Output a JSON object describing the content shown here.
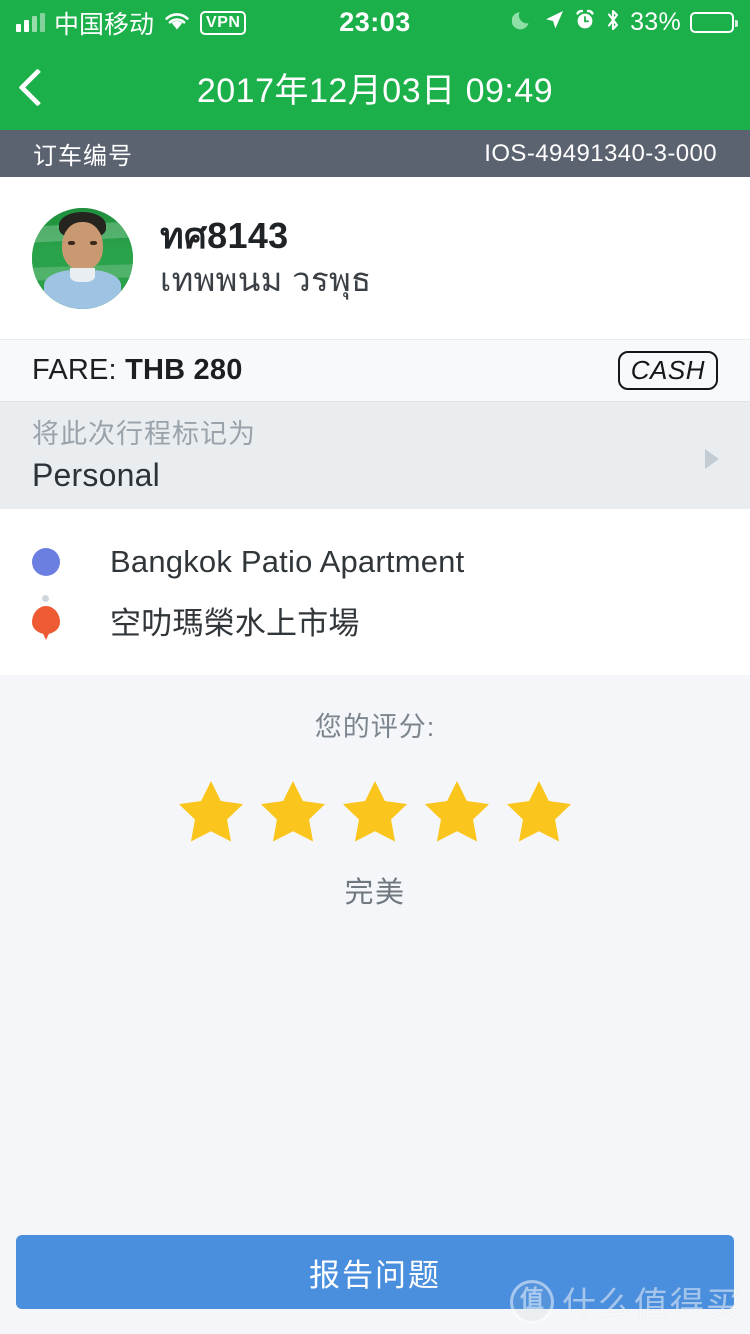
{
  "status_bar": {
    "carrier": "中国移动",
    "vpn": "VPN",
    "time": "23:03",
    "battery_percent": "33%",
    "icons": [
      "signal-icon",
      "wifi-icon",
      "vpn-badge",
      "moon-icon",
      "location-arrow-icon",
      "alarm-clock-icon",
      "bluetooth-icon",
      "battery-icon"
    ]
  },
  "nav": {
    "back_icon": "chevron-left-icon",
    "title": "2017年12月03日 09:49"
  },
  "order": {
    "label": "订车编号",
    "value": "IOS-49491340-3-000"
  },
  "driver": {
    "id": "ทศ8143",
    "name": "เทพพนม วรพุธ",
    "avatar_alt": "driver-photo"
  },
  "fare": {
    "label": "FARE:",
    "amount": "THB 280",
    "payment_badge": "CASH"
  },
  "trip_tag": {
    "caption": "将此次行程标记为",
    "value": "Personal",
    "arrow_icon": "triangle-right-icon"
  },
  "route": {
    "pickup": "Bangkok Patio Apartment",
    "dropoff": "空叻瑪榮水上市場",
    "pickup_icon": "circle-dot-icon",
    "dropoff_icon": "map-pin-icon"
  },
  "rating": {
    "caption": "您的评分:",
    "stars_filled": 5,
    "stars_total": 5,
    "word": "完美"
  },
  "footer": {
    "report_button": "报告问题"
  },
  "watermark": {
    "logo": "值",
    "text": "什么值得买"
  },
  "colors": {
    "brand_green": "#1cb04a",
    "order_bar": "#5b6270",
    "tag_bg": "#e9edf0",
    "star_gold": "#fac51c",
    "pickup_blue": "#6a7fe0",
    "dropoff_orange": "#ee5a33",
    "button_blue": "#4a8ede"
  }
}
